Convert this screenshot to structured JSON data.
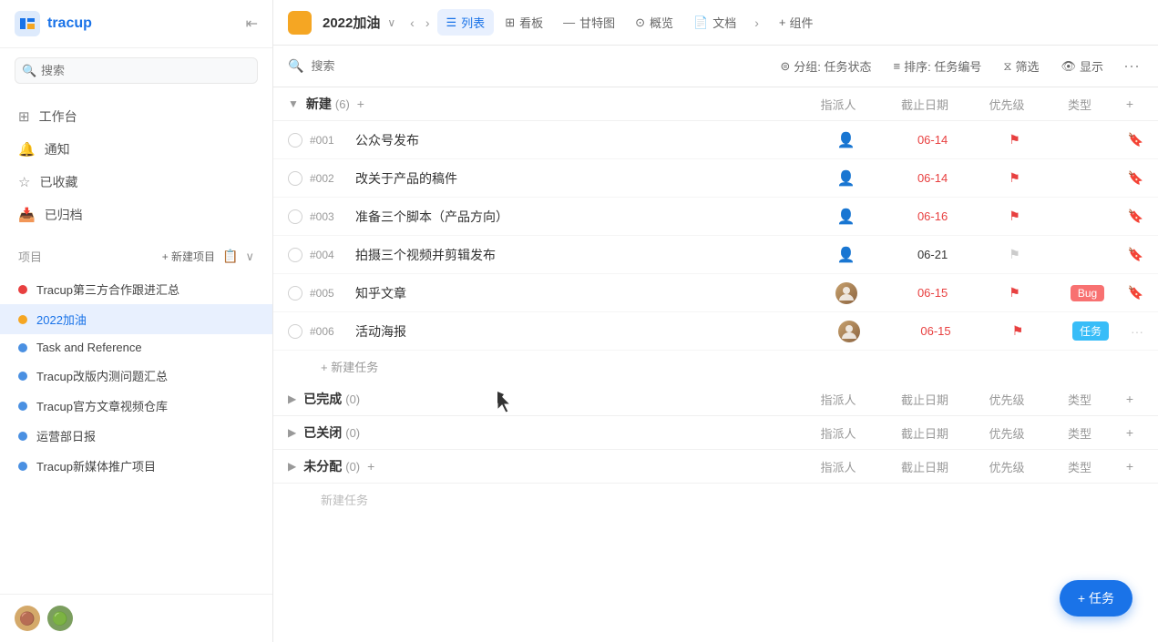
{
  "sidebar": {
    "logo_text": "tracup",
    "search_placeholder": "搜索",
    "nav_items": [
      {
        "id": "workbench",
        "label": "工作台",
        "icon": "⊞"
      },
      {
        "id": "notifications",
        "label": "通知",
        "icon": "🔔"
      },
      {
        "id": "favorites",
        "label": "已收藏",
        "icon": "☆"
      },
      {
        "id": "archived",
        "label": "已归档",
        "icon": "📥"
      }
    ],
    "section_label": "项目",
    "new_project_label": "+ 新建项目",
    "projects": [
      {
        "id": "tracup-collab",
        "label": "Tracup第三方合作跟进汇总",
        "color": "#e84040",
        "active": false
      },
      {
        "id": "2022jiayou",
        "label": "2022加油",
        "color": "#f5a623",
        "active": true
      },
      {
        "id": "task-reference",
        "label": "Task and Reference",
        "color": "#4a90e2",
        "active": false
      },
      {
        "id": "tracup-改版",
        "label": "Tracup改版内测问题汇总",
        "color": "#4a90e2",
        "active": false
      },
      {
        "id": "tracup-official",
        "label": "Tracup官方文章视频仓库",
        "color": "#4a90e2",
        "active": false
      },
      {
        "id": "operations",
        "label": "运营部日报",
        "color": "#4a90e2",
        "active": false
      },
      {
        "id": "tracup-new-media",
        "label": "Tracup新媒体推广项目",
        "color": "#4a90e2",
        "active": false
      }
    ]
  },
  "topbar": {
    "project_title": "2022加油",
    "views": [
      {
        "id": "list",
        "label": "列表",
        "active": true,
        "icon": "☰"
      },
      {
        "id": "board",
        "label": "看板",
        "active": false,
        "icon": "⊞"
      },
      {
        "id": "gantt",
        "label": "甘特图",
        "active": false,
        "icon": "—"
      },
      {
        "id": "overview",
        "label": "概览",
        "active": false,
        "icon": "⊙"
      },
      {
        "id": "docs",
        "label": "文档",
        "active": false,
        "icon": "📄"
      }
    ],
    "add_component_label": "组件"
  },
  "toolbar": {
    "search_placeholder": "搜索",
    "group_label": "分组: 任务状态",
    "sort_label": "排序: 任务编号",
    "filter_label": "筛选",
    "display_label": "显示"
  },
  "sections": [
    {
      "id": "new",
      "title": "新建",
      "count": "(6)",
      "collapsed": false,
      "tasks": [
        {
          "id": "#001",
          "name": "公众号发布",
          "assignee": null,
          "date": "06-14",
          "date_red": true,
          "priority": "red",
          "type": null
        },
        {
          "id": "#002",
          "name": "改关于产品的稿件",
          "assignee": null,
          "date": "06-14",
          "date_red": true,
          "priority": "red",
          "type": null
        },
        {
          "id": "#003",
          "name": "准备三个脚本（产品方向）",
          "assignee": null,
          "date": "06-16",
          "date_red": true,
          "priority": "red",
          "type": null
        },
        {
          "id": "#004",
          "name": "拍摄三个视频并剪辑发布",
          "assignee": null,
          "date": "06-21",
          "date_red": false,
          "priority": "gray",
          "type": null
        },
        {
          "id": "#005",
          "name": "知乎文章",
          "assignee": "avatar",
          "date": "06-15",
          "date_red": true,
          "priority": "red",
          "type": "Bug"
        },
        {
          "id": "#006",
          "name": "活动海报",
          "assignee": "avatar",
          "date": "06-15",
          "date_red": true,
          "priority": "red",
          "type": "任务"
        }
      ],
      "add_task_label": "+ 新建任务",
      "col_headers": [
        "指派人",
        "截止日期",
        "优先级",
        "类型"
      ]
    },
    {
      "id": "completed",
      "title": "已完成",
      "count": "(0)",
      "collapsed": true,
      "tasks": [],
      "col_headers": [
        "指派人",
        "截止日期",
        "优先级",
        "类型"
      ]
    },
    {
      "id": "closed",
      "title": "已关闭",
      "count": "(0)",
      "collapsed": true,
      "tasks": [],
      "col_headers": [
        "指派人",
        "截止日期",
        "优先级",
        "类型"
      ]
    },
    {
      "id": "unassigned",
      "title": "未分配",
      "count": "(0)",
      "collapsed": true,
      "tasks": [],
      "add_task_label": "新建任务",
      "col_headers": [
        "指派人",
        "截止日期",
        "优先级",
        "类型"
      ]
    }
  ],
  "fab": {
    "label": "+ 任务"
  }
}
